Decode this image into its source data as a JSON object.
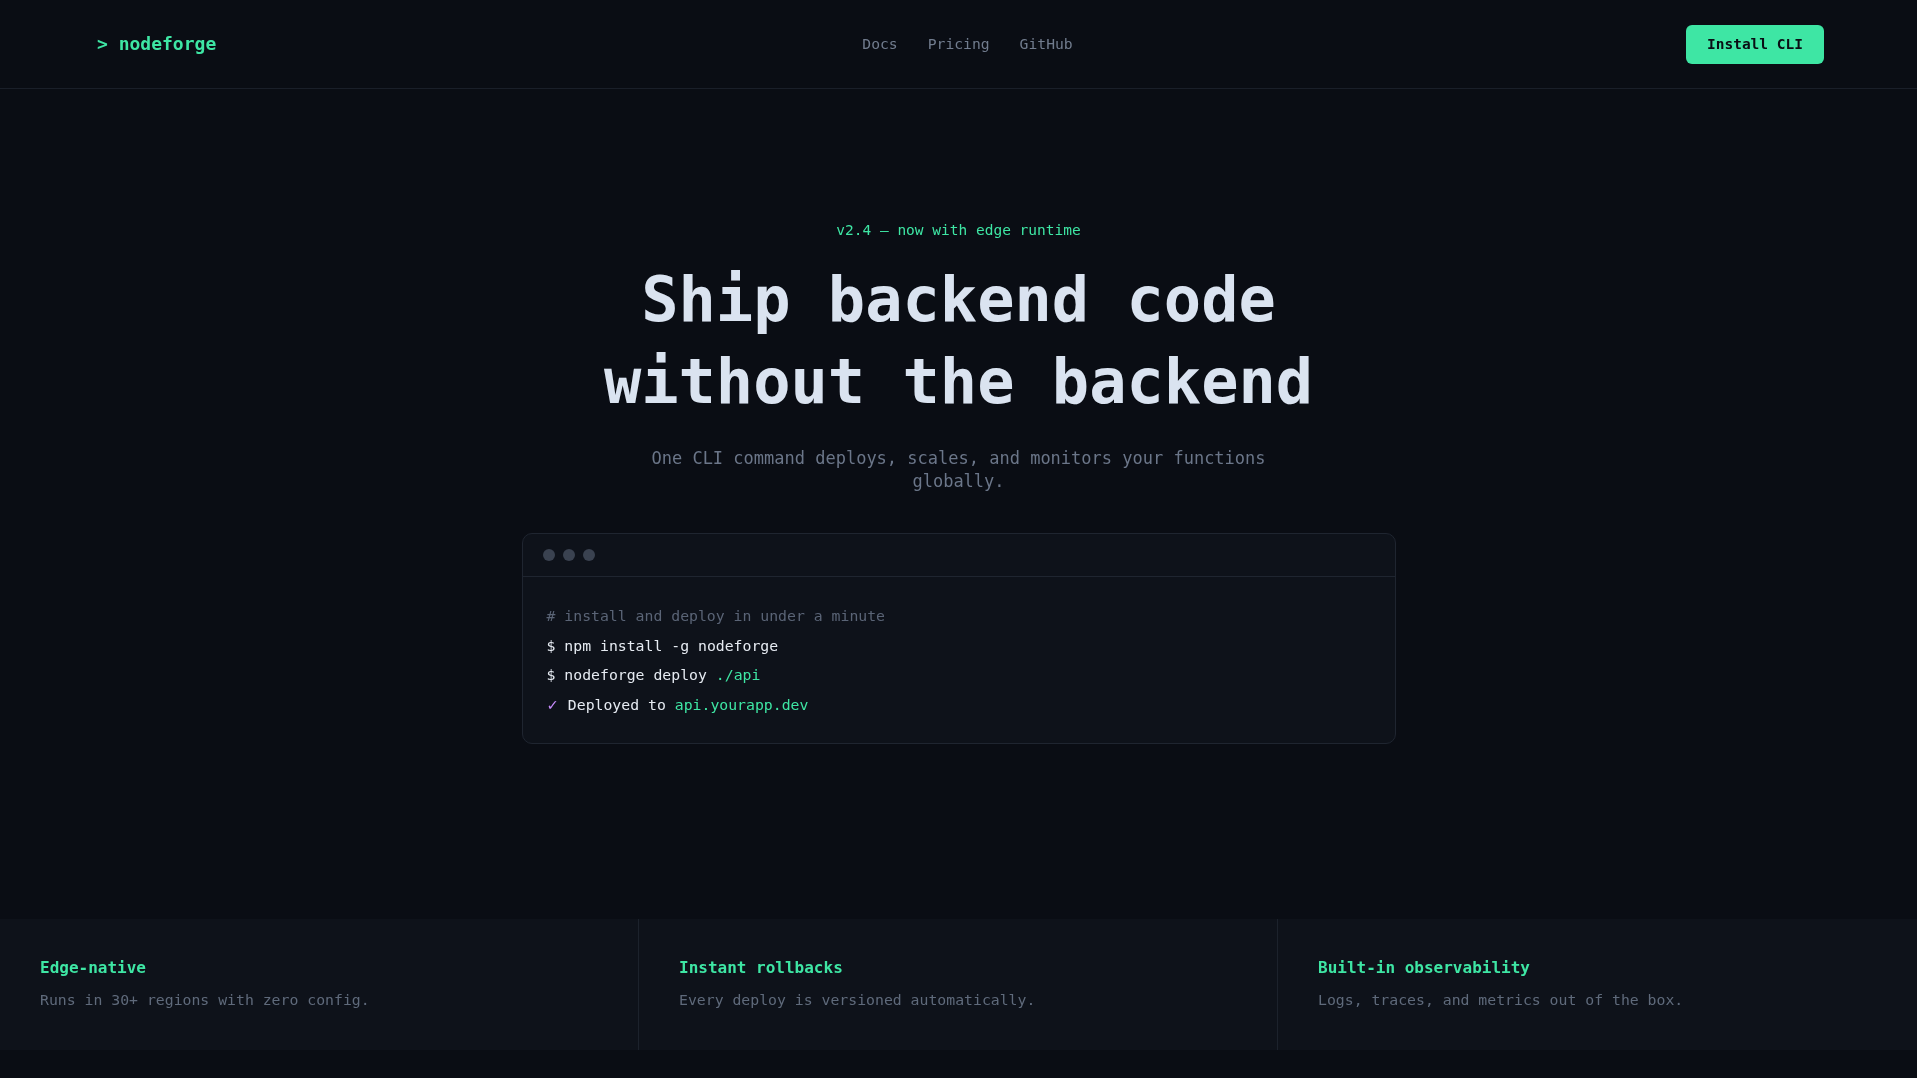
{
  "header": {
    "logo": {
      "prompt": ">",
      "name": "nodeforge"
    },
    "nav": [
      "Docs",
      "Pricing",
      "GitHub"
    ],
    "cta": "Install CLI"
  },
  "hero": {
    "badge": "v2.4 — now with edge runtime",
    "title": "Ship backend code without the backend",
    "subtitle": "One CLI command deploys, scales, and monitors your functions globally.",
    "terminal": {
      "lines": [
        {
          "kind": "comment",
          "text": "# install and deploy in under a minute"
        },
        {
          "kind": "command",
          "prompt": "$",
          "text": "npm install -g nodeforge"
        },
        {
          "kind": "command",
          "prompt": "$",
          "text": "nodeforge deploy",
          "path": "./api"
        },
        {
          "kind": "success",
          "prompt": "✓",
          "text": "Deployed to",
          "path": "api.yourapp.dev"
        }
      ]
    }
  },
  "features": [
    {
      "title": "Edge-native",
      "description": "Runs in 30+ regions with zero config."
    },
    {
      "title": "Instant rollbacks",
      "description": "Every deploy is versioned automatically."
    },
    {
      "title": "Built-in observability",
      "description": "Logs, traces, and metrics out of the box."
    }
  ]
}
